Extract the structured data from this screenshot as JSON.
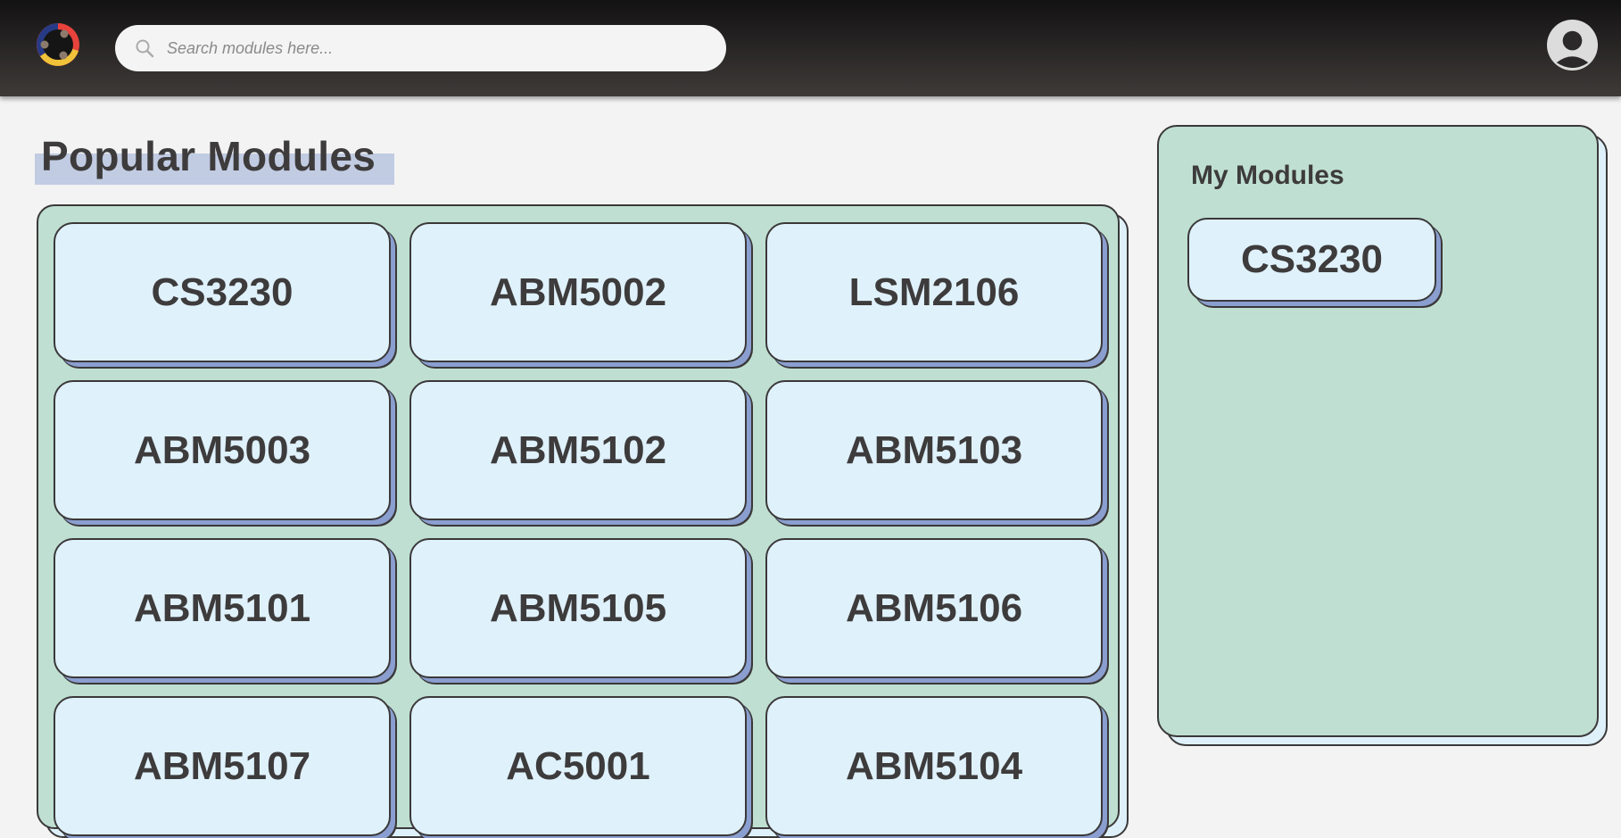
{
  "header": {
    "search": {
      "placeholder": "Search modules here..."
    }
  },
  "popular": {
    "title": "Popular Modules",
    "modules": [
      "CS3230",
      "ABM5002",
      "LSM2106",
      "ABM5003",
      "ABM5102",
      "ABM5103",
      "ABM5101",
      "ABM5105",
      "ABM5106",
      "ABM5107",
      "AC5001",
      "ABM5104"
    ]
  },
  "my_modules": {
    "title": "My Modules",
    "modules": [
      "CS3230"
    ]
  },
  "colors": {
    "panel": "#bfdfd3",
    "card": "#dff1fb",
    "card_shadow": "#8a9fcf",
    "title_highlight": "#c1cbe2"
  }
}
